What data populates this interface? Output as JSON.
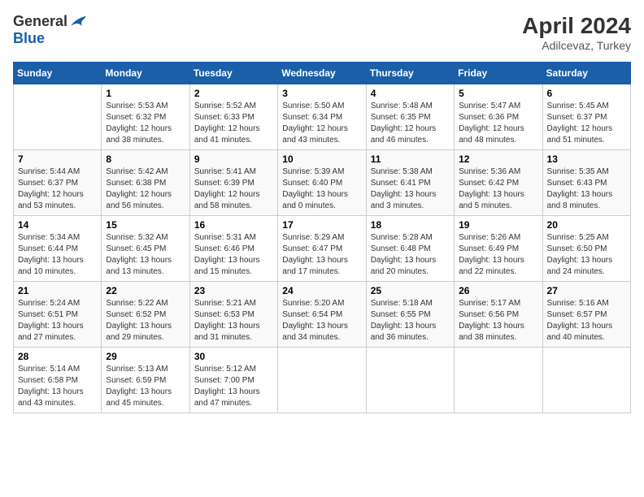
{
  "header": {
    "logo_general": "General",
    "logo_blue": "Blue",
    "month_title": "April 2024",
    "location": "Adilcevaz, Turkey"
  },
  "weekdays": [
    "Sunday",
    "Monday",
    "Tuesday",
    "Wednesday",
    "Thursday",
    "Friday",
    "Saturday"
  ],
  "weeks": [
    [
      {
        "day": "",
        "info": ""
      },
      {
        "day": "1",
        "info": "Sunrise: 5:53 AM\nSunset: 6:32 PM\nDaylight: 12 hours\nand 38 minutes."
      },
      {
        "day": "2",
        "info": "Sunrise: 5:52 AM\nSunset: 6:33 PM\nDaylight: 12 hours\nand 41 minutes."
      },
      {
        "day": "3",
        "info": "Sunrise: 5:50 AM\nSunset: 6:34 PM\nDaylight: 12 hours\nand 43 minutes."
      },
      {
        "day": "4",
        "info": "Sunrise: 5:48 AM\nSunset: 6:35 PM\nDaylight: 12 hours\nand 46 minutes."
      },
      {
        "day": "5",
        "info": "Sunrise: 5:47 AM\nSunset: 6:36 PM\nDaylight: 12 hours\nand 48 minutes."
      },
      {
        "day": "6",
        "info": "Sunrise: 5:45 AM\nSunset: 6:37 PM\nDaylight: 12 hours\nand 51 minutes."
      }
    ],
    [
      {
        "day": "7",
        "info": "Sunrise: 5:44 AM\nSunset: 6:37 PM\nDaylight: 12 hours\nand 53 minutes."
      },
      {
        "day": "8",
        "info": "Sunrise: 5:42 AM\nSunset: 6:38 PM\nDaylight: 12 hours\nand 56 minutes."
      },
      {
        "day": "9",
        "info": "Sunrise: 5:41 AM\nSunset: 6:39 PM\nDaylight: 12 hours\nand 58 minutes."
      },
      {
        "day": "10",
        "info": "Sunrise: 5:39 AM\nSunset: 6:40 PM\nDaylight: 13 hours\nand 0 minutes."
      },
      {
        "day": "11",
        "info": "Sunrise: 5:38 AM\nSunset: 6:41 PM\nDaylight: 13 hours\nand 3 minutes."
      },
      {
        "day": "12",
        "info": "Sunrise: 5:36 AM\nSunset: 6:42 PM\nDaylight: 13 hours\nand 5 minutes."
      },
      {
        "day": "13",
        "info": "Sunrise: 5:35 AM\nSunset: 6:43 PM\nDaylight: 13 hours\nand 8 minutes."
      }
    ],
    [
      {
        "day": "14",
        "info": "Sunrise: 5:34 AM\nSunset: 6:44 PM\nDaylight: 13 hours\nand 10 minutes."
      },
      {
        "day": "15",
        "info": "Sunrise: 5:32 AM\nSunset: 6:45 PM\nDaylight: 13 hours\nand 13 minutes."
      },
      {
        "day": "16",
        "info": "Sunrise: 5:31 AM\nSunset: 6:46 PM\nDaylight: 13 hours\nand 15 minutes."
      },
      {
        "day": "17",
        "info": "Sunrise: 5:29 AM\nSunset: 6:47 PM\nDaylight: 13 hours\nand 17 minutes."
      },
      {
        "day": "18",
        "info": "Sunrise: 5:28 AM\nSunset: 6:48 PM\nDaylight: 13 hours\nand 20 minutes."
      },
      {
        "day": "19",
        "info": "Sunrise: 5:26 AM\nSunset: 6:49 PM\nDaylight: 13 hours\nand 22 minutes."
      },
      {
        "day": "20",
        "info": "Sunrise: 5:25 AM\nSunset: 6:50 PM\nDaylight: 13 hours\nand 24 minutes."
      }
    ],
    [
      {
        "day": "21",
        "info": "Sunrise: 5:24 AM\nSunset: 6:51 PM\nDaylight: 13 hours\nand 27 minutes."
      },
      {
        "day": "22",
        "info": "Sunrise: 5:22 AM\nSunset: 6:52 PM\nDaylight: 13 hours\nand 29 minutes."
      },
      {
        "day": "23",
        "info": "Sunrise: 5:21 AM\nSunset: 6:53 PM\nDaylight: 13 hours\nand 31 minutes."
      },
      {
        "day": "24",
        "info": "Sunrise: 5:20 AM\nSunset: 6:54 PM\nDaylight: 13 hours\nand 34 minutes."
      },
      {
        "day": "25",
        "info": "Sunrise: 5:18 AM\nSunset: 6:55 PM\nDaylight: 13 hours\nand 36 minutes."
      },
      {
        "day": "26",
        "info": "Sunrise: 5:17 AM\nSunset: 6:56 PM\nDaylight: 13 hours\nand 38 minutes."
      },
      {
        "day": "27",
        "info": "Sunrise: 5:16 AM\nSunset: 6:57 PM\nDaylight: 13 hours\nand 40 minutes."
      }
    ],
    [
      {
        "day": "28",
        "info": "Sunrise: 5:14 AM\nSunset: 6:58 PM\nDaylight: 13 hours\nand 43 minutes."
      },
      {
        "day": "29",
        "info": "Sunrise: 5:13 AM\nSunset: 6:59 PM\nDaylight: 13 hours\nand 45 minutes."
      },
      {
        "day": "30",
        "info": "Sunrise: 5:12 AM\nSunset: 7:00 PM\nDaylight: 13 hours\nand 47 minutes."
      },
      {
        "day": "",
        "info": ""
      },
      {
        "day": "",
        "info": ""
      },
      {
        "day": "",
        "info": ""
      },
      {
        "day": "",
        "info": ""
      }
    ]
  ]
}
